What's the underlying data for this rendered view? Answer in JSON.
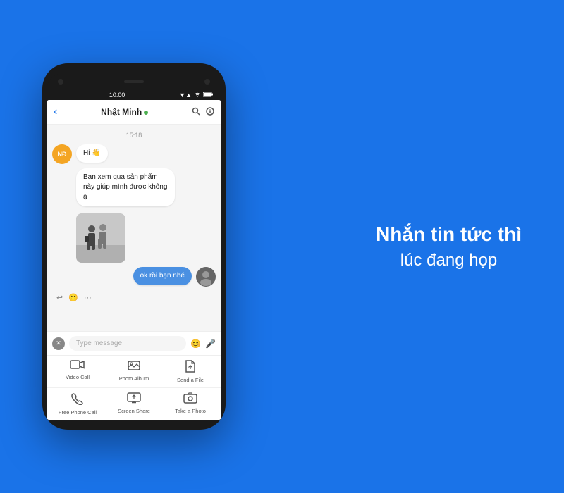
{
  "background_color": "#1a73e8",
  "right_text": {
    "bold": "Nhắn tin tức thì",
    "light": "lúc đang họp"
  },
  "phone": {
    "status_bar": {
      "time": "10:00",
      "signal": "▼▲▐▐",
      "wifi": "WiFi",
      "battery": "100"
    },
    "chat_header": {
      "back_label": "‹",
      "contact_name": "Nhật Minh",
      "online": true,
      "search_label": "🔍",
      "info_label": "ⓘ"
    },
    "time_divider": "15:18",
    "messages": [
      {
        "id": "msg1",
        "sender": "other",
        "avatar_text": "NĐ",
        "avatar_color": "#f4a523",
        "text": "Hi 👋",
        "type": "text"
      },
      {
        "id": "msg2",
        "sender": "other",
        "text": "Bạn xem qua sản phẩm này giúp mình được không ạ",
        "type": "text"
      },
      {
        "id": "msg3",
        "sender": "other",
        "type": "image"
      },
      {
        "id": "msg4",
        "sender": "me",
        "text": "ok rồi bạn nhé",
        "type": "text"
      }
    ],
    "reactions": {
      "reply": "↩",
      "emoji": "🙂",
      "more": "···"
    },
    "input": {
      "placeholder": "Type message",
      "emoji_icon": "😊",
      "mic_icon": "🎤",
      "close_icon": "✕"
    },
    "toolbar_rows": [
      {
        "items": [
          {
            "id": "video-call",
            "icon": "video",
            "label": "Video Call"
          },
          {
            "id": "photo-album",
            "icon": "photo",
            "label": "Photo Album"
          },
          {
            "id": "send-file",
            "icon": "file",
            "label": "Send a File"
          }
        ]
      },
      {
        "items": [
          {
            "id": "free-phone-call",
            "icon": "phone",
            "label": "Free Phone Call"
          },
          {
            "id": "screen-share",
            "icon": "screen",
            "label": "Screen Share"
          },
          {
            "id": "take-photo",
            "icon": "camera",
            "label": "Take a Photo"
          }
        ]
      }
    ]
  }
}
